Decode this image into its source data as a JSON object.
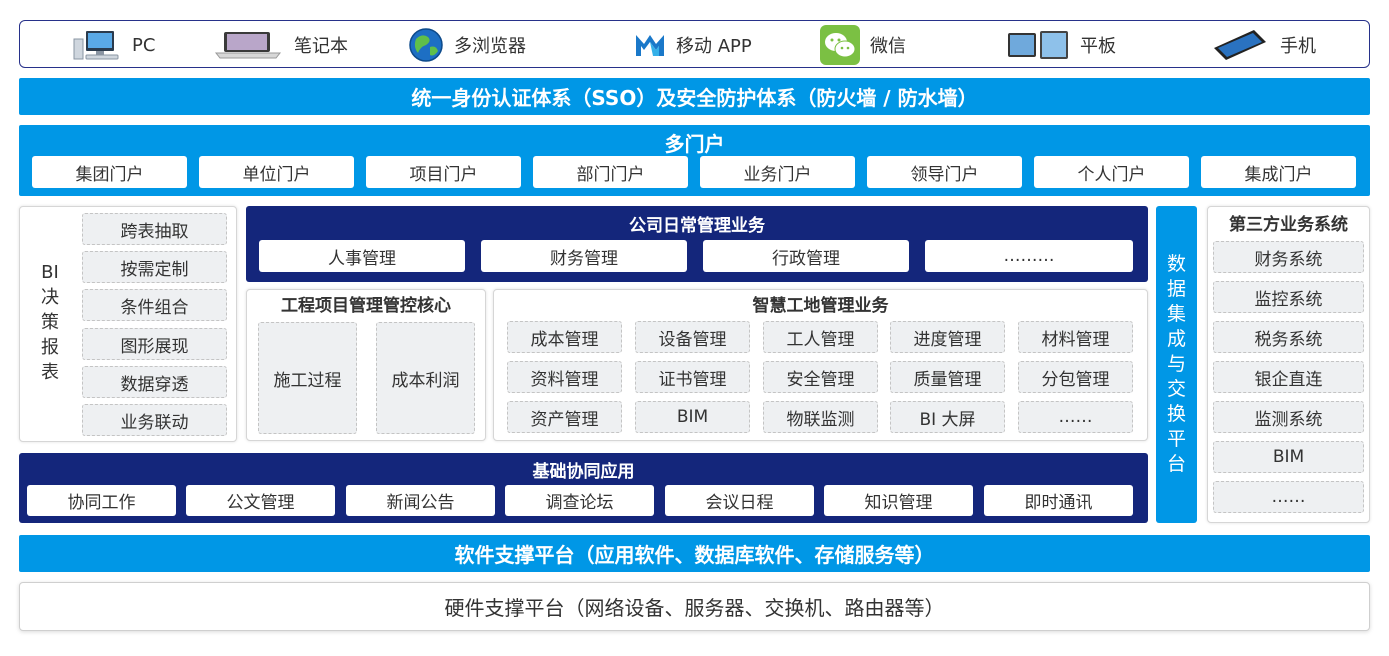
{
  "devices": [
    {
      "label": "PC",
      "icon": "desktop-pc-icon"
    },
    {
      "label": "笔记本",
      "icon": "laptop-icon"
    },
    {
      "label": "多浏览器",
      "icon": "globe-browser-icon"
    },
    {
      "label": "移动 APP",
      "icon": "mobile-app-logo-icon"
    },
    {
      "label": "微信",
      "icon": "wechat-icon"
    },
    {
      "label": "平板",
      "icon": "tablet-icon"
    },
    {
      "label": "手机",
      "icon": "smartphone-icon"
    }
  ],
  "sso_bar": "统一身份认证体系（SSO）及安全防护体系（防火墙 / 防水墙）",
  "portals": {
    "title": "多门户",
    "items": [
      "集团门户",
      "单位门户",
      "项目门户",
      "部门门户",
      "业务门户",
      "领导门户",
      "个人门户",
      "集成门户"
    ]
  },
  "bi": {
    "title_chars": [
      "BI",
      "决",
      "策",
      "报",
      "表"
    ],
    "items": [
      "跨表抽取",
      "按需定制",
      "条件组合",
      "图形展现",
      "数据穿透",
      "业务联动"
    ]
  },
  "daily": {
    "title": "公司日常管理业务",
    "items": [
      "人事管理",
      "财务管理",
      "行政管理",
      "………"
    ]
  },
  "project": {
    "title": "工程项目管理管控核心",
    "items": [
      "施工过程",
      "成本利润"
    ]
  },
  "smart_site": {
    "title": "智慧工地管理业务",
    "rows": [
      [
        "成本管理",
        "设备管理",
        "工人管理",
        "进度管理",
        "材料管理"
      ],
      [
        "资料管理",
        "证书管理",
        "安全管理",
        "质量管理",
        "分包管理"
      ],
      [
        "资产管理",
        "BIM",
        "物联监测",
        "BI 大屏",
        "……"
      ]
    ]
  },
  "basic": {
    "title": "基础协同应用",
    "items": [
      "协同工作",
      "公文管理",
      "新闻公告",
      "调查论坛",
      "会议日程",
      "知识管理",
      "即时通讯"
    ]
  },
  "data_exchange_chars": [
    "数",
    "据",
    "集",
    "成",
    "与",
    "交",
    "换",
    "平",
    "台"
  ],
  "third_party": {
    "title": "第三方业务系统",
    "items": [
      "财务系统",
      "监控系统",
      "税务系统",
      "银企直连",
      "监测系统",
      "BIM",
      "……"
    ]
  },
  "software_bar": "软件支撑平台（应用软件、数据库软件、存储服务等）",
  "hardware_bar": "硬件支撑平台（网络设备、服务器、交换机、路由器等）",
  "colors": {
    "accent_blue": "#0097e6",
    "navy": "#14267b",
    "pill_bg": "#eef0f2"
  }
}
